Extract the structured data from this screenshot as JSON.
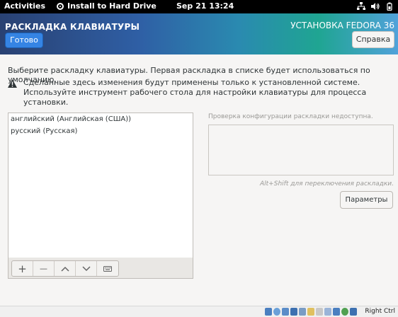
{
  "topbar": {
    "activities": "Activities",
    "app_name": "Install to Hard Drive",
    "clock": "Sep 21  13:24"
  },
  "header": {
    "spoke_title": "РАСКЛАДКА КЛАВИАТУРЫ",
    "done_label": "Готово",
    "installer_title": "УСТАНОВКА FEDORA 36",
    "help_label": "Справка"
  },
  "main": {
    "intro": "Выберите раскладку клавиатуры. Первая раскладка в списке будет использоваться по умолчанию.",
    "warning": "Сделанные здесь изменения будут применены только к установленной системе. Используйте инструмент рабочего стола для настройки клавиатуры для процесса установки.",
    "layouts": [
      {
        "label": "английский (Английская (США))"
      },
      {
        "label": "русский (Русская)"
      }
    ],
    "toolbar": {
      "add_symbol": "+",
      "remove_symbol": "—",
      "up_icon": "chevron-up-icon",
      "down_icon": "chevron-down-icon",
      "preview_icon": "keyboard-icon"
    },
    "preview_label": "Проверка конфигурации раскладки недоступна.",
    "switch_hint": "Alt+Shift для переключения раскладки.",
    "options_label": "Параметры"
  },
  "statusbar": {
    "host_key": "Right Ctrl"
  },
  "colors": {
    "accent_blue": "#3584e4",
    "header_start": "#294172",
    "header_end": "#51a2da"
  }
}
